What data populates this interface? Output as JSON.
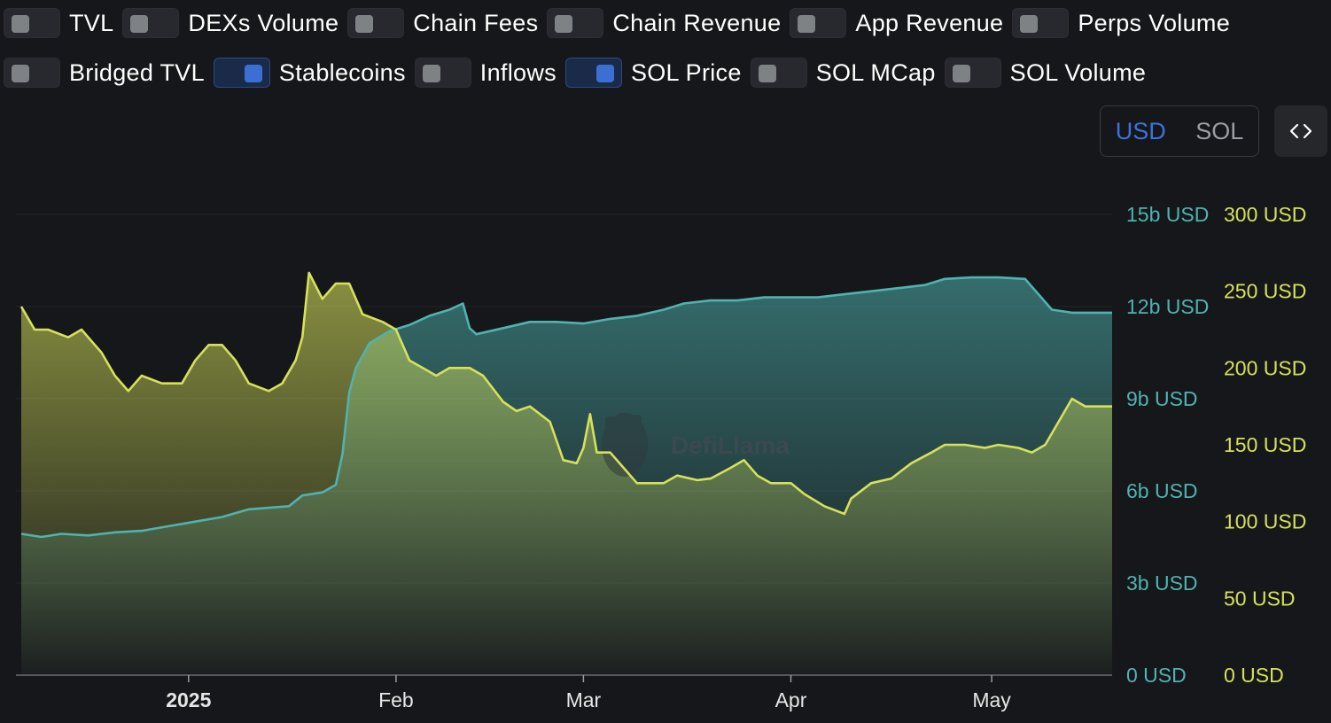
{
  "toggles": [
    {
      "label": "TVL",
      "on": false
    },
    {
      "label": "DEXs Volume",
      "on": false
    },
    {
      "label": "Chain Fees",
      "on": false
    },
    {
      "label": "Chain Revenue",
      "on": false
    },
    {
      "label": "App Revenue",
      "on": false
    },
    {
      "label": "Perps Volume",
      "on": false
    },
    {
      "label": "Bridged TVL",
      "on": false
    },
    {
      "label": "Stablecoins",
      "on": true
    },
    {
      "label": "Inflows",
      "on": false
    },
    {
      "label": "SOL Price",
      "on": true
    },
    {
      "label": "SOL MCap",
      "on": false
    },
    {
      "label": "SOL Volume",
      "on": false
    }
  ],
  "denomination": {
    "options": [
      "USD",
      "SOL"
    ],
    "selected": "USD"
  },
  "embed_icon": "code-icon",
  "watermark": "DefiLlama",
  "colors": {
    "stablecoins": "#4fb3b0",
    "sol_price": "#d6e15a",
    "accent": "#3b73db"
  },
  "chart_data": {
    "type": "area",
    "x_ticks": [
      {
        "label": "2025",
        "date": "2025-01-01",
        "bold": true
      },
      {
        "label": "Feb",
        "date": "2025-02-01",
        "bold": false
      },
      {
        "label": "Mar",
        "date": "2025-03-01",
        "bold": false
      },
      {
        "label": "Apr",
        "date": "2025-04-01",
        "bold": false
      },
      {
        "label": "May",
        "date": "2025-05-01",
        "bold": false
      }
    ],
    "xlim": [
      "2024-12-07",
      "2025-05-19"
    ],
    "y_left": {
      "unit": "b USD",
      "ticks": [
        "0 USD",
        "3b USD",
        "6b USD",
        "9b USD",
        "12b USD",
        "15b USD"
      ],
      "ylim": [
        0,
        15
      ],
      "color": "#4fb3b0"
    },
    "y_right": {
      "unit": "USD",
      "ticks": [
        "0 USD",
        "50 USD",
        "100 USD",
        "150 USD",
        "200 USD",
        "250 USD",
        "300 USD"
      ],
      "ylim": [
        0,
        300
      ],
      "color": "#d6e15a"
    },
    "series": [
      {
        "name": "Stablecoins",
        "axis": "left",
        "color": "#4fb3b0",
        "points": [
          [
            "2024-12-07",
            4.6
          ],
          [
            "2024-12-10",
            4.5
          ],
          [
            "2024-12-13",
            4.6
          ],
          [
            "2024-12-17",
            4.55
          ],
          [
            "2024-12-21",
            4.65
          ],
          [
            "2024-12-25",
            4.7
          ],
          [
            "2024-12-29",
            4.85
          ],
          [
            "2025-01-02",
            5.0
          ],
          [
            "2025-01-06",
            5.15
          ],
          [
            "2025-01-10",
            5.4
          ],
          [
            "2025-01-13",
            5.45
          ],
          [
            "2025-01-16",
            5.5
          ],
          [
            "2025-01-18",
            5.85
          ],
          [
            "2025-01-21",
            5.95
          ],
          [
            "2025-01-23",
            6.2
          ],
          [
            "2025-01-24",
            7.2
          ],
          [
            "2025-01-25",
            9.2
          ],
          [
            "2025-01-26",
            10.0
          ],
          [
            "2025-01-28",
            10.8
          ],
          [
            "2025-01-31",
            11.2
          ],
          [
            "2025-02-03",
            11.4
          ],
          [
            "2025-02-06",
            11.7
          ],
          [
            "2025-02-09",
            11.9
          ],
          [
            "2025-02-11",
            12.1
          ],
          [
            "2025-02-12",
            11.3
          ],
          [
            "2025-02-13",
            11.1
          ],
          [
            "2025-02-17",
            11.3
          ],
          [
            "2025-02-21",
            11.5
          ],
          [
            "2025-02-25",
            11.5
          ],
          [
            "2025-03-01",
            11.45
          ],
          [
            "2025-03-05",
            11.6
          ],
          [
            "2025-03-09",
            11.7
          ],
          [
            "2025-03-13",
            11.9
          ],
          [
            "2025-03-16",
            12.1
          ],
          [
            "2025-03-20",
            12.2
          ],
          [
            "2025-03-24",
            12.2
          ],
          [
            "2025-03-28",
            12.3
          ],
          [
            "2025-04-01",
            12.3
          ],
          [
            "2025-04-05",
            12.3
          ],
          [
            "2025-04-09",
            12.4
          ],
          [
            "2025-04-13",
            12.5
          ],
          [
            "2025-04-17",
            12.6
          ],
          [
            "2025-04-21",
            12.7
          ],
          [
            "2025-04-24",
            12.9
          ],
          [
            "2025-04-28",
            12.95
          ],
          [
            "2025-05-02",
            12.95
          ],
          [
            "2025-05-06",
            12.9
          ],
          [
            "2025-05-08",
            12.4
          ],
          [
            "2025-05-10",
            11.9
          ],
          [
            "2025-05-13",
            11.8
          ],
          [
            "2025-05-19",
            11.8
          ]
        ]
      },
      {
        "name": "SOL Price",
        "axis": "right",
        "color": "#d6e15a",
        "points": [
          [
            "2024-12-07",
            240
          ],
          [
            "2024-12-09",
            225
          ],
          [
            "2024-12-11",
            225
          ],
          [
            "2024-12-14",
            220
          ],
          [
            "2024-12-16",
            225
          ],
          [
            "2024-12-19",
            210
          ],
          [
            "2024-12-21",
            195
          ],
          [
            "2024-12-23",
            185
          ],
          [
            "2024-12-25",
            195
          ],
          [
            "2024-12-28",
            190
          ],
          [
            "2024-12-31",
            190
          ],
          [
            "2025-01-02",
            205
          ],
          [
            "2025-01-04",
            215
          ],
          [
            "2025-01-06",
            215
          ],
          [
            "2025-01-08",
            205
          ],
          [
            "2025-01-10",
            190
          ],
          [
            "2025-01-13",
            185
          ],
          [
            "2025-01-15",
            190
          ],
          [
            "2025-01-17",
            205
          ],
          [
            "2025-01-18",
            220
          ],
          [
            "2025-01-19",
            262
          ],
          [
            "2025-01-21",
            245
          ],
          [
            "2025-01-23",
            255
          ],
          [
            "2025-01-25",
            255
          ],
          [
            "2025-01-27",
            235
          ],
          [
            "2025-01-30",
            230
          ],
          [
            "2025-02-01",
            225
          ],
          [
            "2025-02-03",
            205
          ],
          [
            "2025-02-05",
            200
          ],
          [
            "2025-02-07",
            195
          ],
          [
            "2025-02-09",
            200
          ],
          [
            "2025-02-12",
            200
          ],
          [
            "2025-02-14",
            195
          ],
          [
            "2025-02-17",
            178
          ],
          [
            "2025-02-19",
            172
          ],
          [
            "2025-02-21",
            175
          ],
          [
            "2025-02-24",
            165
          ],
          [
            "2025-02-26",
            140
          ],
          [
            "2025-02-28",
            138
          ],
          [
            "2025-03-01",
            148
          ],
          [
            "2025-03-02",
            170
          ],
          [
            "2025-03-03",
            145
          ],
          [
            "2025-03-05",
            145
          ],
          [
            "2025-03-07",
            135
          ],
          [
            "2025-03-09",
            125
          ],
          [
            "2025-03-11",
            125
          ],
          [
            "2025-03-13",
            125
          ],
          [
            "2025-03-15",
            130
          ],
          [
            "2025-03-18",
            127
          ],
          [
            "2025-03-20",
            128
          ],
          [
            "2025-03-23",
            135
          ],
          [
            "2025-03-25",
            140
          ],
          [
            "2025-03-27",
            130
          ],
          [
            "2025-03-29",
            125
          ],
          [
            "2025-04-01",
            125
          ],
          [
            "2025-04-03",
            118
          ],
          [
            "2025-04-06",
            110
          ],
          [
            "2025-04-09",
            105
          ],
          [
            "2025-04-10",
            115
          ],
          [
            "2025-04-13",
            125
          ],
          [
            "2025-04-16",
            128
          ],
          [
            "2025-04-19",
            138
          ],
          [
            "2025-04-22",
            145
          ],
          [
            "2025-04-24",
            150
          ],
          [
            "2025-04-27",
            150
          ],
          [
            "2025-04-30",
            148
          ],
          [
            "2025-05-02",
            150
          ],
          [
            "2025-05-05",
            148
          ],
          [
            "2025-05-07",
            145
          ],
          [
            "2025-05-09",
            150
          ],
          [
            "2025-05-11",
            165
          ],
          [
            "2025-05-13",
            180
          ],
          [
            "2025-05-15",
            175
          ],
          [
            "2025-05-19",
            175
          ]
        ]
      }
    ],
    "grid": true,
    "legend": "none"
  }
}
